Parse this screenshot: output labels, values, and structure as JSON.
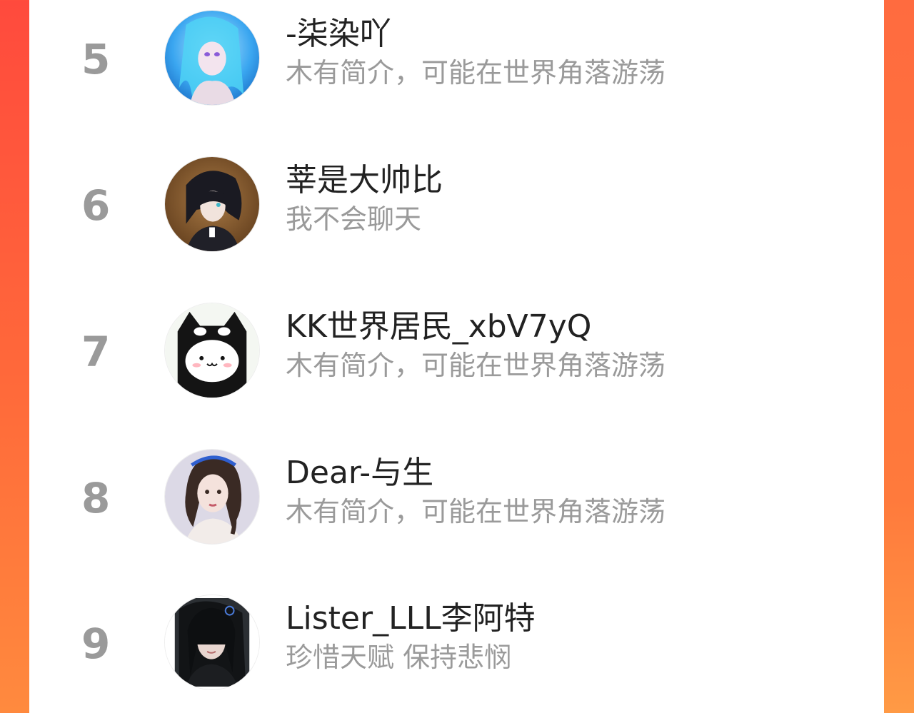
{
  "ranking": {
    "items": [
      {
        "rank": "5",
        "name": "-柒染吖",
        "bio": "木有简介，可能在世界角落游荡",
        "avatar_icon": "anime-girl-blue-hair-avatar"
      },
      {
        "rank": "6",
        "name": "莘是大帅比",
        "bio": "我不会聊天",
        "avatar_icon": "anime-boy-dark-hair-avatar"
      },
      {
        "rank": "7",
        "name": "KK世界居民_xbV7yQ",
        "bio": "木有简介，可能在世界角落游荡",
        "avatar_icon": "black-cat-hood-avatar"
      },
      {
        "rank": "8",
        "name": "Dear-与生",
        "bio": "木有简介，可能在世界角落游荡",
        "avatar_icon": "illustrated-girl-avatar"
      },
      {
        "rank": "9",
        "name": "Lister_LLL李阿特",
        "bio": "珍惜天赋 保持悲悯",
        "avatar_icon": "photo-girl-avatar"
      }
    ]
  },
  "colors": {
    "background_left": "#ff4a3d",
    "background_right": "#ff7a3c",
    "rank_gray": "#9a9a9a",
    "name_text": "#222222",
    "bio_text": "#9a9a9a"
  }
}
